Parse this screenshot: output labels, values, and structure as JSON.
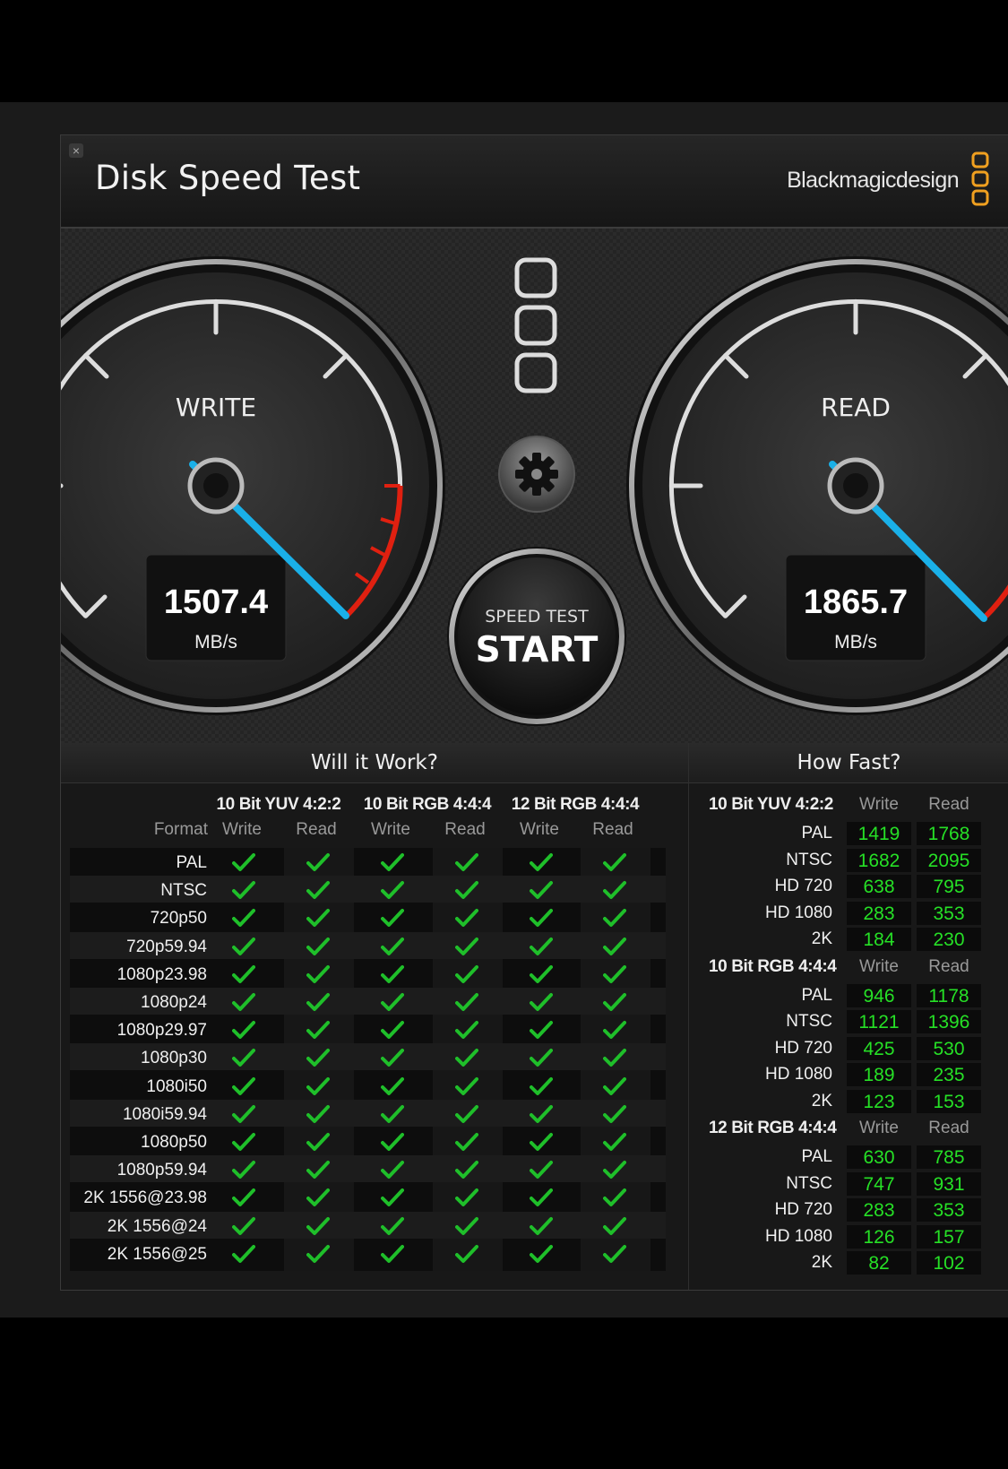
{
  "window": {
    "title": "Disk Speed Test",
    "brand": "Blackmagicdesign",
    "close_label": "×"
  },
  "gauges": {
    "write": {
      "label": "WRITE",
      "value": "1507.4",
      "unit": "MB/s"
    },
    "read": {
      "label": "READ",
      "value": "1865.7",
      "unit": "MB/s"
    }
  },
  "controls": {
    "settings_icon": "gear-icon",
    "start_small": "SPEED TEST",
    "start_big": "START"
  },
  "will_it_work": {
    "title": "Will it Work?",
    "format_header": "Format",
    "groups": [
      "10 Bit YUV 4:2:2",
      "10 Bit RGB 4:4:4",
      "12 Bit RGB 4:4:4"
    ],
    "subheaders": [
      "Write",
      "Read",
      "Write",
      "Read",
      "Write",
      "Read"
    ],
    "formats": [
      "PAL",
      "NTSC",
      "720p50",
      "720p59.94",
      "1080p23.98",
      "1080p24",
      "1080p29.97",
      "1080p30",
      "1080i50",
      "1080i59.94",
      "1080p50",
      "1080p59.94",
      "2K 1556@23.98",
      "2K 1556@24",
      "2K 1556@25"
    ]
  },
  "how_fast": {
    "title": "How Fast?",
    "groups": [
      {
        "name": "10 Bit YUV 4:2:2",
        "write": "Write",
        "read": "Read",
        "rows": [
          {
            "format": "PAL",
            "write": "1419",
            "read": "1768"
          },
          {
            "format": "NTSC",
            "write": "1682",
            "read": "2095"
          },
          {
            "format": "HD 720",
            "write": "638",
            "read": "795"
          },
          {
            "format": "HD 1080",
            "write": "283",
            "read": "353"
          },
          {
            "format": "2K",
            "write": "184",
            "read": "230"
          }
        ]
      },
      {
        "name": "10 Bit RGB 4:4:4",
        "write": "Write",
        "read": "Read",
        "rows": [
          {
            "format": "PAL",
            "write": "946",
            "read": "1178"
          },
          {
            "format": "NTSC",
            "write": "1121",
            "read": "1396"
          },
          {
            "format": "HD 720",
            "write": "425",
            "read": "530"
          },
          {
            "format": "HD 1080",
            "write": "189",
            "read": "235"
          },
          {
            "format": "2K",
            "write": "123",
            "read": "153"
          }
        ]
      },
      {
        "name": "12 Bit RGB 4:4:4",
        "write": "Write",
        "read": "Read",
        "rows": [
          {
            "format": "PAL",
            "write": "630",
            "read": "785"
          },
          {
            "format": "NTSC",
            "write": "747",
            "read": "931"
          },
          {
            "format": "HD 720",
            "write": "283",
            "read": "353"
          },
          {
            "format": "HD 1080",
            "write": "126",
            "read": "157"
          },
          {
            "format": "2K",
            "write": "82",
            "read": "102"
          }
        ]
      }
    ]
  },
  "colors": {
    "check": "#1fbf2a",
    "value_green": "#26e026",
    "needle": "#1ab0e8",
    "redline": "#e02010",
    "logo_orange": "#f0a020"
  }
}
